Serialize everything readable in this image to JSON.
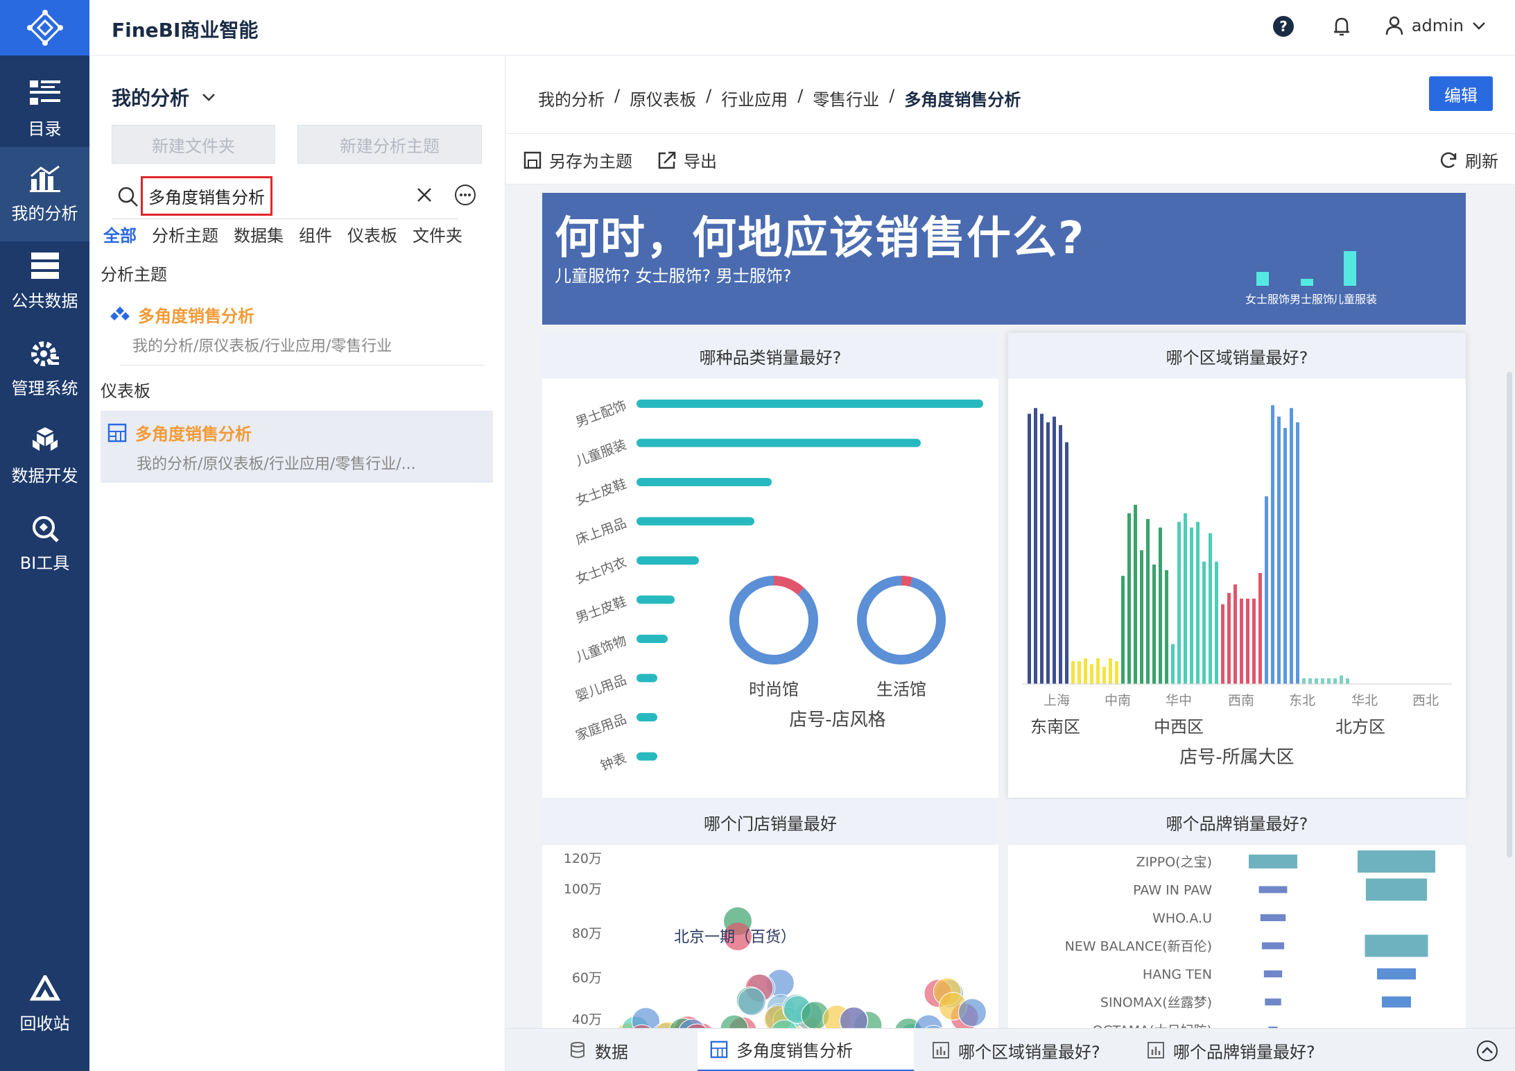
{
  "nav": {
    "items": [
      {
        "label": "目录",
        "icon": "catalog-icon"
      },
      {
        "label": "我的分析",
        "icon": "my-analysis-icon"
      },
      {
        "label": "公共数据",
        "icon": "public-data-icon"
      },
      {
        "label": "管理系统",
        "icon": "system-management-icon"
      },
      {
        "label": "数据开发",
        "icon": "data-dev-icon"
      },
      {
        "label": "BI工具",
        "icon": "bi-tools-icon"
      },
      {
        "label": "回收站",
        "icon": "recycle-bin-icon"
      }
    ]
  },
  "header": {
    "brand": "FineBI商业智能",
    "user": "admin"
  },
  "panel": {
    "title": "我的分析",
    "new_folder": "新建文件夹",
    "new_subject": "新建分析主题",
    "search_value": "多角度销售分析",
    "filters": [
      "全部",
      "分析主题",
      "数据集",
      "组件",
      "仪表板",
      "文件夹"
    ],
    "section_subject": "分析主题",
    "section_dashboard": "仪表板",
    "result1": {
      "title": "多角度销售分析",
      "path": "我的分析/原仪表板/行业应用/零售行业"
    },
    "result2": {
      "title": "多角度销售分析",
      "path": "我的分析/原仪表板/行业应用/零售行业/..."
    }
  },
  "main": {
    "breadcrumb": [
      "我的分析",
      "原仪表板",
      "行业应用",
      "零售行业",
      "多角度销售分析"
    ],
    "separator": "/",
    "edit": "编辑",
    "save_as": "另存为主题",
    "export": "导出",
    "refresh": "刷新"
  },
  "banner": {
    "title": "何时，何地应该销售什么?",
    "subtitle": "儿童服饰? 女士服饰? 男士服饰?",
    "mini": [
      {
        "label": "女士服饰",
        "value": 2
      },
      {
        "label": "男士服饰",
        "value": 1
      },
      {
        "label": "儿童服装",
        "value": 5
      }
    ]
  },
  "cards": {
    "category": "哪种品类销量最好?",
    "region": "哪个区域销量最好?",
    "store": "哪个门店销量最好",
    "brand": "哪个品牌销量最好?"
  },
  "chart_data": [
    {
      "type": "bar",
      "orientation": "horizontal",
      "title": "哪种品类销量最好?",
      "categories": [
        "男士配饰",
        "儿童服装",
        "女士皮鞋",
        "床上用品",
        "女士内衣",
        "男士皮鞋",
        "儿童饰物",
        "婴儿用品",
        "家庭用品",
        "钟表"
      ],
      "values": [
        100,
        82,
        39,
        34,
        18,
        11,
        9,
        6,
        6,
        6
      ]
    },
    {
      "type": "pie",
      "title": "店号-店风格",
      "charts": [
        {
          "label": "时尚馆",
          "slices": [
            0.88,
            0.12
          ],
          "colors": [
            "#5b8fd6",
            "#e0566c"
          ]
        },
        {
          "label": "生活馆",
          "slices": [
            0.96,
            0.04
          ],
          "colors": [
            "#5b8fd6",
            "#e0566c"
          ]
        }
      ]
    },
    {
      "type": "bar",
      "title": "哪个区域销量最好?",
      "xlabel": "店号-所属大区",
      "tick_labels": [
        "上海",
        "中南",
        "华中",
        "西南",
        "东北",
        "华北",
        "西北"
      ],
      "group_labels": [
        "东南区",
        "中西区",
        "北方区"
      ],
      "groups": [
        {
          "color": "#3d4f8f",
          "values": [
            95,
            97,
            95,
            92,
            94,
            91,
            85
          ]
        },
        {
          "color": "#f5e342",
          "values": [
            8,
            8,
            9,
            7,
            9,
            6,
            9,
            8
          ]
        },
        {
          "color": "#3aa36b",
          "values": [
            38,
            60,
            63,
            47,
            58,
            42,
            55,
            40
          ]
        },
        {
          "color": "#4ecdb6",
          "values": [
            14,
            57,
            60,
            55,
            57,
            43,
            53,
            43
          ]
        },
        {
          "color": "#e0566c",
          "values": [
            28,
            32,
            35,
            30,
            30,
            30,
            39
          ]
        },
        {
          "color": "#5b97e0",
          "values": [
            66,
            98,
            94,
            90,
            97,
            92
          ]
        },
        {
          "color": "#7fd0c4",
          "values": [
            2,
            2,
            2,
            2,
            2,
            2,
            3,
            2
          ]
        }
      ]
    },
    {
      "type": "scatter",
      "title": "哪个门店销量最好",
      "y_ticks": [
        "120万",
        "100万",
        "80万",
        "60万",
        "40万"
      ],
      "annotation": "北京一期（百货）"
    },
    {
      "type": "bar",
      "orientation": "horizontal",
      "title": "哪个品牌销量最好?",
      "categories": [
        "ZIPPO(之宝)",
        "PAW IN PAW",
        "WHO.A.U",
        "NEW BALANCE(新百伦)",
        "HANG TEN",
        "SINOMAX(丝露梦)",
        "OGTAMA(大日妃防)"
      ],
      "series": [
        {
          "values": [
            48,
            28,
            25,
            22,
            18,
            16,
            9
          ]
        },
        {
          "values": [
            80,
            63,
            0,
            65,
            40,
            30
          ]
        }
      ]
    }
  ],
  "bottom_tabs": [
    "数据",
    "多角度销售分析",
    "哪个区域销量最好?",
    "哪个品牌销量最好?"
  ]
}
